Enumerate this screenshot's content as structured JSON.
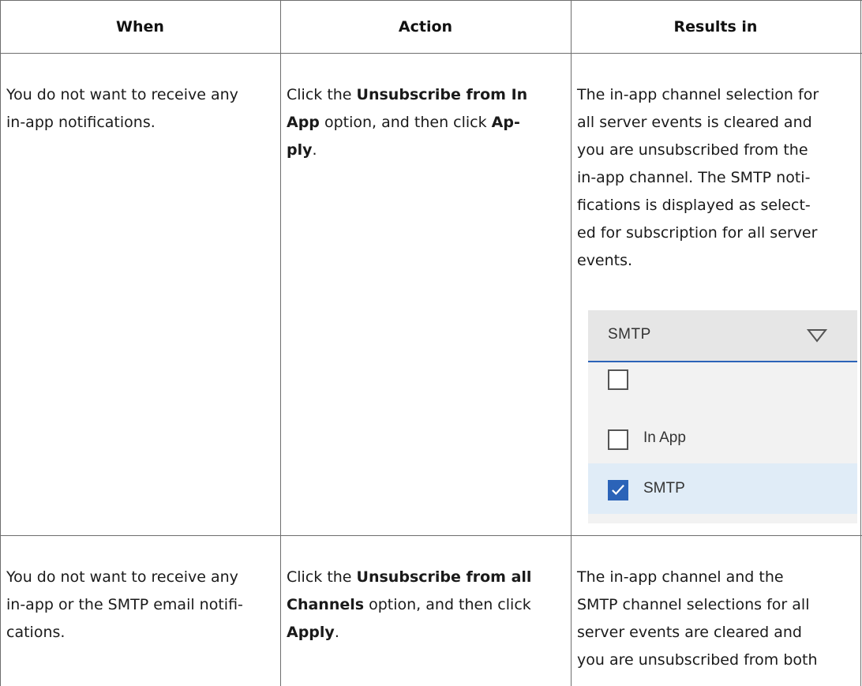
{
  "headers": {
    "when": "When",
    "action": "Action",
    "results": "Results in"
  },
  "rows": [
    {
      "when": [
        "You do not want to receive any",
        "in-app notifications."
      ],
      "action": {
        "l1_pre": "Click the ",
        "l1_bold": "Unsubscribe from In",
        "l2_bold": "App",
        "l2_mid": " option, and then click ",
        "l2_bold2": "Ap-",
        "l3_bold": "ply",
        "l3_post": "."
      },
      "results": [
        "The in-app channel selection for",
        "all server events is cleared and",
        "you are unsubscribed from the",
        "in-app channel. The SMTP noti-",
        "fications is displayed as select-",
        "ed for subscription for all server",
        "events."
      ],
      "dropdown": {
        "selected": "SMTP",
        "chevron_icon": "chevron-down-icon",
        "options": [
          {
            "label": "",
            "checked": false
          },
          {
            "label": "In App",
            "checked": false
          },
          {
            "label": "SMTP",
            "checked": true
          }
        ],
        "accent_color": "#2b63b8",
        "highlight_color": "#e0ecf7"
      }
    },
    {
      "when": [
        "You do not want to receive any",
        "in-app or the SMTP email notifi-",
        "cations."
      ],
      "action": {
        "l1_pre": "Click the ",
        "l1_bold": "Unsubscribe from all",
        "l2_bold": "Channels",
        "l2_post": " option, and then click",
        "l3_bold": "Apply",
        "l3_post": "."
      },
      "results": [
        "The in-app channel and the",
        "SMTP channel selections for all",
        "server events are cleared and",
        "you are unsubscribed from both"
      ]
    }
  ]
}
